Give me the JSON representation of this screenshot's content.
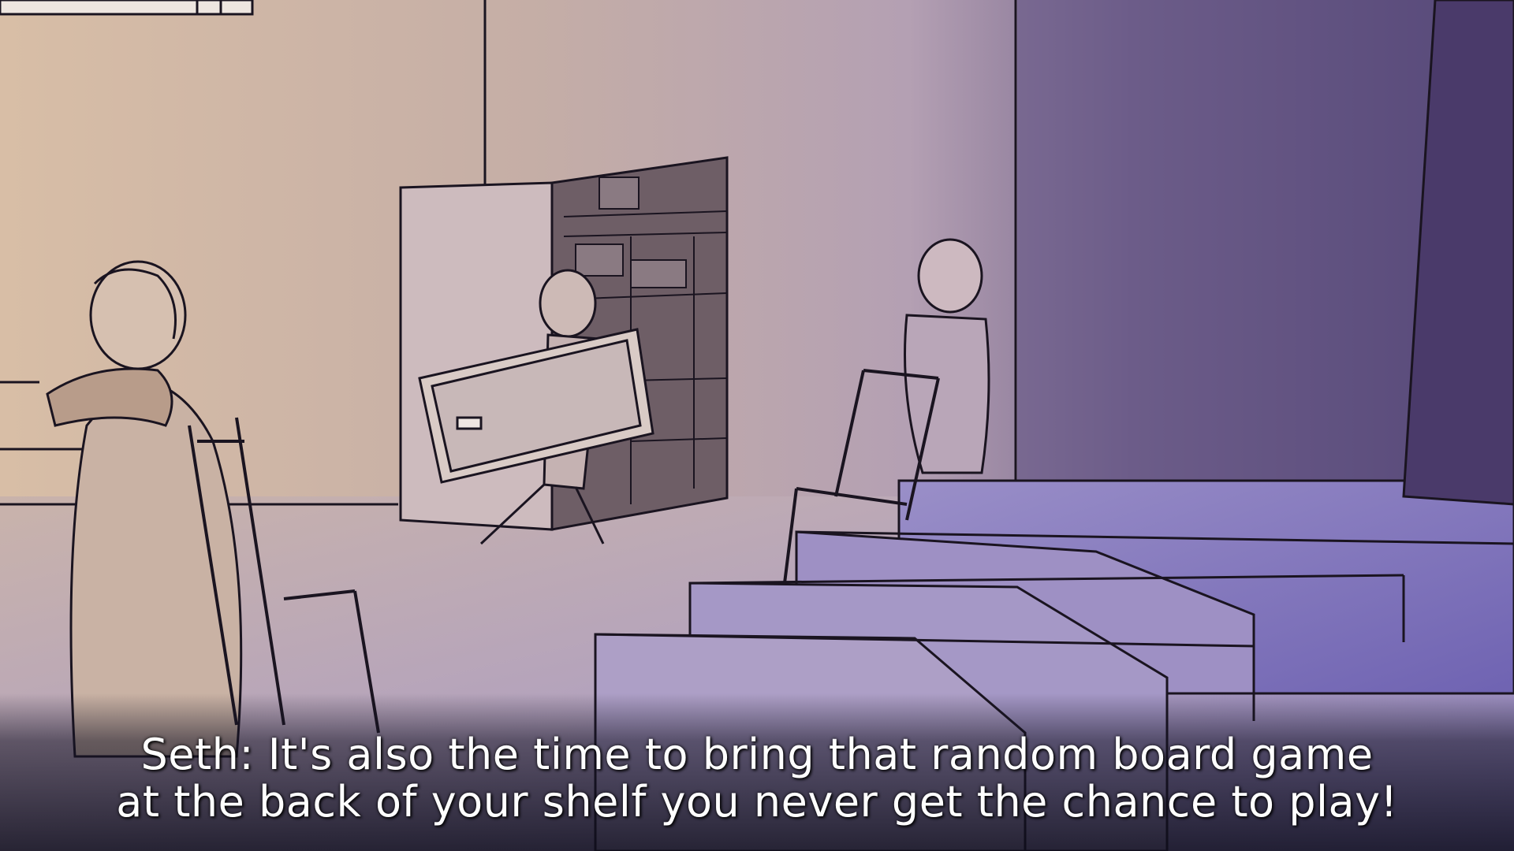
{
  "scene": {
    "palette": {
      "wall_warm": "#d9bfa8",
      "wall_mid": "#b9a3b0",
      "wall_cool": "#5a4a78",
      "floor_light": "#b7a6c0",
      "stage_violet": "#7d72b8",
      "ink": "#1a1420"
    },
    "characters": [
      "seth-with-chair",
      "girl-carrying-board",
      "boy-holding-chair"
    ]
  },
  "dialogue": {
    "speaker": "Seth",
    "line1": "Seth: It's also the time to bring that random board game",
    "line2": "at the back of your shelf you never get the chance to play!"
  }
}
